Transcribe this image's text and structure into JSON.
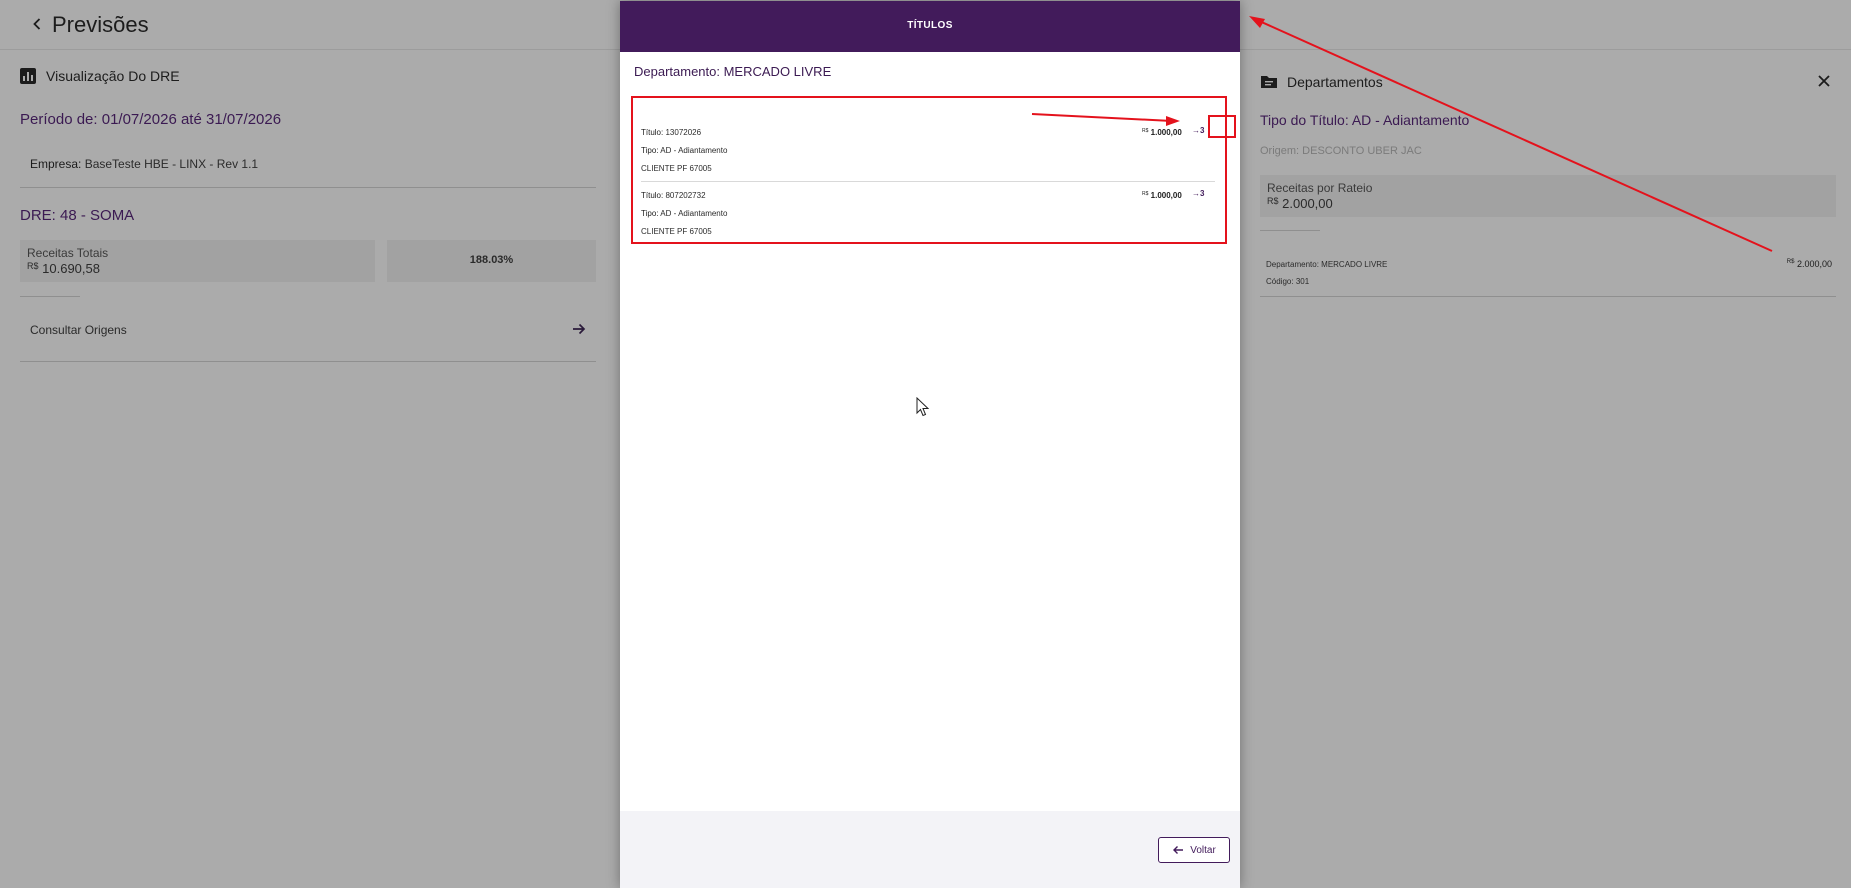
{
  "page": {
    "title": "Previsões"
  },
  "left_panel": {
    "section_title": "Visualização Do DRE",
    "periodo": "Período de: 01/07/2026 até 31/07/2026",
    "empresa_label": "Empresa:",
    "empresa_value": "BaseTeste HBE - LINX - Rev 1.1",
    "dre": "DRE: 48 - SOMA",
    "receitas_label": "Receitas Totais",
    "currency": "R$",
    "receitas_value": "10.690,58",
    "percent": "188.03%",
    "consultar": "Consultar Origens"
  },
  "right_panel": {
    "title": "Departamentos",
    "tipo": "Tipo do Título: AD - Adiantamento",
    "origem": "Origem: DESCONTO UBER JAC",
    "rateio_label": "Receitas por Rateio",
    "currency": "R$",
    "rateio_value": "2.000,00",
    "dep_label": "Departamento:",
    "dep_value": "MERCADO LIVRE",
    "codigo_label": "Código:",
    "codigo_value": "301",
    "dep_amount": "2.000,00"
  },
  "modal": {
    "title": "TÍTULOS",
    "department": "Departamento: MERCADO LIVRE",
    "currency": "R$",
    "go_label": "→3",
    "items": [
      {
        "titulo_label": "Título:",
        "titulo": "13072026",
        "tipo_label": "Tipo:",
        "tipo": "AD - Adiantamento",
        "cliente": "CLIENTE PF 67005",
        "valor": "1.000,00"
      },
      {
        "titulo_label": "Título:",
        "titulo": "807202732",
        "tipo_label": "Tipo:",
        "tipo": "AD - Adiantamento",
        "cliente": "CLIENTE PF 67005",
        "valor": "1.000,00"
      }
    ],
    "voltar": "Voltar"
  },
  "colors": {
    "accent": "#421b5b",
    "annotation": "#e4121c",
    "overlay": "#ababab"
  }
}
